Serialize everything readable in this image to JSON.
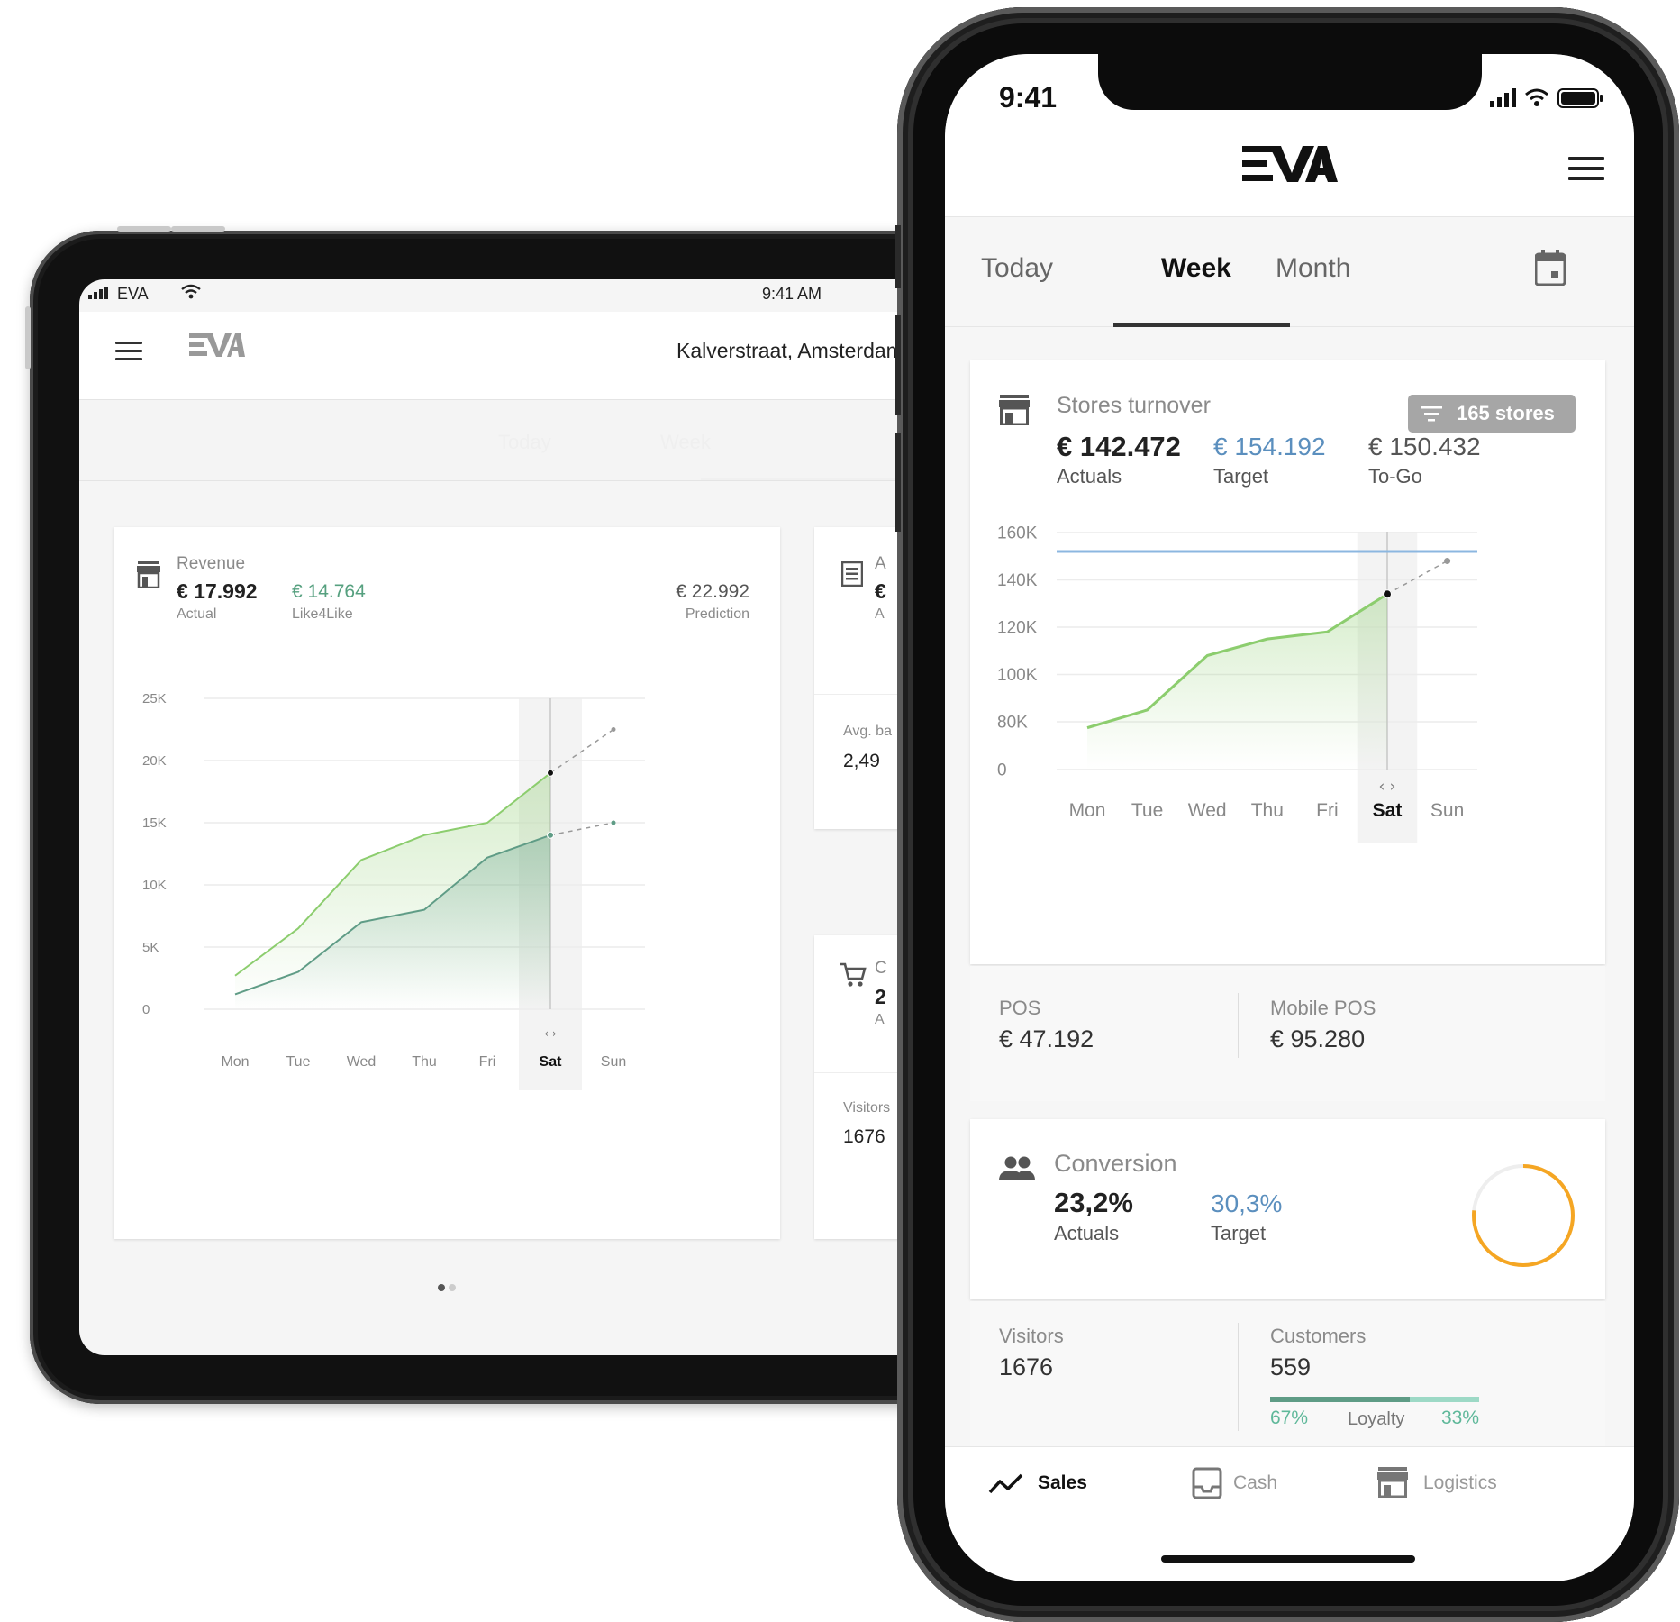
{
  "tablet": {
    "status": {
      "carrier": "EVA",
      "time": "9:41 AM"
    },
    "location": "Kalverstraat, Amsterdam",
    "tabs": [
      "Today",
      "Week"
    ],
    "revenue_card": {
      "title": "Revenue",
      "actual_value": "€ 17.992",
      "actual_label": "Actual",
      "like_value": "€ 14.764",
      "like_label": "Like4Like",
      "prediction_value": "€ 22.992",
      "prediction_label": "Prediction"
    },
    "side_card_1": {
      "title_fragment": "A",
      "value_fragment": "€",
      "label_fragment": "A",
      "sub_label": "Avg. ba",
      "sub_value": "2,49"
    },
    "side_card_2": {
      "title_fragment": "C",
      "value_fragment": "2",
      "label_fragment": "A",
      "sub_label": "Visitors",
      "sub_value": "1676"
    }
  },
  "phone": {
    "status": {
      "time": "9:41"
    },
    "tabs": {
      "today": "Today",
      "week": "Week",
      "month": "Month",
      "active": "Week"
    },
    "turnover_card": {
      "title": "Stores turnover",
      "filter_badge": "165 stores",
      "actuals_value": "€ 142.472",
      "actuals_label": "Actuals",
      "target_value": "€ 154.192",
      "target_label": "Target",
      "togo_value": "€ 150.432",
      "togo_label": "To-Go",
      "pos_label": "POS",
      "pos_value": "€ 47.192",
      "mobile_pos_label": "Mobile POS",
      "mobile_pos_value": "€ 95.280"
    },
    "conversion_card": {
      "title": "Conversion",
      "actuals_value": "23,2%",
      "actuals_label": "Actuals",
      "target_value": "30,3%",
      "target_label": "Target",
      "progress": 0.766,
      "visitors_label": "Visitors",
      "visitors_value": "1676",
      "customers_label": "Customers",
      "customers_value": "559",
      "loyalty_left": "67%",
      "loyalty_label": "Loyalty",
      "loyalty_right": "33%",
      "loyalty_fraction": 0.67
    },
    "bottom_nav": {
      "sales": "Sales",
      "cash": "Cash",
      "logistics": "Logistics",
      "active": "Sales"
    }
  },
  "colors": {
    "accent_green": "#8ccd6e",
    "secondary_green": "#5f9c86",
    "target_blue": "#8cb7e0",
    "ring_orange": "#f5a623"
  },
  "chart_data": [
    {
      "type": "line",
      "categories": [
        "Mon",
        "Tue",
        "Wed",
        "Thu",
        "Fri",
        "Sat",
        "Sun"
      ],
      "highlighted": "Sat",
      "y_ticks": [
        "0",
        "5K",
        "10K",
        "15K",
        "20K",
        "25K"
      ],
      "ylim": [
        0,
        25000
      ],
      "series": [
        {
          "values": [
            2700,
            6500,
            12000,
            14000,
            15000,
            19000,
            null
          ],
          "color": "#8ccd6e",
          "projected": [
            [
              5,
              19000
            ],
            [
              6,
              22500
            ]
          ]
        },
        {
          "values": [
            1200,
            3000,
            7000,
            8000,
            12200,
            14000,
            null
          ],
          "color": "#5f9c86",
          "projected": [
            [
              5,
              14000
            ],
            [
              6,
              15000
            ]
          ]
        }
      ],
      "grid": true
    },
    {
      "type": "line",
      "categories": [
        "Mon",
        "Tue",
        "Wed",
        "Thu",
        "Fri",
        "Sat",
        "Sun"
      ],
      "highlighted": "Sat",
      "y_ticks": [
        "0",
        "80K",
        "100K",
        "120K",
        "140K",
        "160K"
      ],
      "series": [
        {
          "values": [
            70000,
            85000,
            108000,
            115000,
            118000,
            134000,
            null
          ],
          "color": "#8ccd6e",
          "projected": [
            [
              5,
              134000
            ],
            [
              6,
              148000
            ]
          ]
        }
      ],
      "target_line": 152000,
      "grid": true
    }
  ]
}
